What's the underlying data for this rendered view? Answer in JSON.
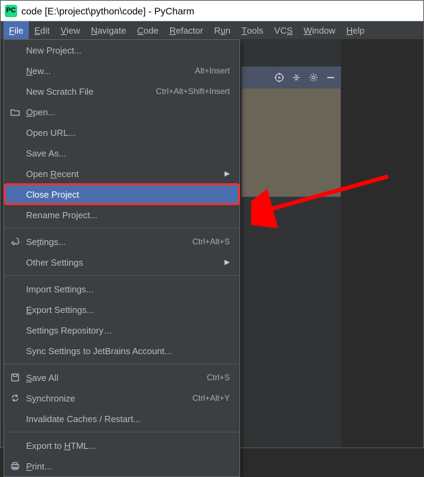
{
  "window": {
    "title": "code [E:\\project\\python\\code] - PyCharm"
  },
  "menubar": {
    "items": [
      {
        "label": "File",
        "underline": "F",
        "active": true
      },
      {
        "label": "Edit",
        "underline": "E"
      },
      {
        "label": "View",
        "underline": "V"
      },
      {
        "label": "Navigate",
        "underline": "N"
      },
      {
        "label": "Code",
        "underline": "C"
      },
      {
        "label": "Refactor",
        "underline": "R"
      },
      {
        "label": "Run",
        "underline": "u"
      },
      {
        "label": "Tools",
        "underline": "T"
      },
      {
        "label": "VCS",
        "underline": "S"
      },
      {
        "label": "Window",
        "underline": "W"
      },
      {
        "label": "Help",
        "underline": "H"
      }
    ]
  },
  "file_menu": {
    "groups": [
      [
        {
          "label": "New Project..."
        },
        {
          "label": "New...",
          "underline": "N",
          "shortcut": "Alt+Insert"
        },
        {
          "label": "New Scratch File",
          "shortcut": "Ctrl+Alt+Shift+Insert"
        },
        {
          "label": "Open...",
          "underline": "O",
          "icon": "folder-open-icon"
        },
        {
          "label": "Open URL..."
        },
        {
          "label": "Save As..."
        },
        {
          "label": "Open Recent",
          "underline": "R",
          "submenu": true
        },
        {
          "label": "Close Project",
          "selected": true
        },
        {
          "label": "Rename Project..."
        }
      ],
      [
        {
          "label": "Settings...",
          "underline": "t",
          "shortcut": "Ctrl+Alt+S",
          "icon": "wrench-icon"
        },
        {
          "label": "Other Settings",
          "submenu": true
        }
      ],
      [
        {
          "label": "Import Settings..."
        },
        {
          "label": "Export Settings...",
          "underline": "E"
        },
        {
          "label": "Settings Repository…"
        },
        {
          "label": "Sync Settings to JetBrains Account..."
        }
      ],
      [
        {
          "label": "Save All",
          "underline": "S",
          "shortcut": "Ctrl+S",
          "icon": "save-icon"
        },
        {
          "label": "Synchronize",
          "underline": "y",
          "shortcut": "Ctrl+Alt+Y",
          "icon": "sync-icon"
        },
        {
          "label": "Invalidate Caches / Restart..."
        }
      ],
      [
        {
          "label": "Export to HTML...",
          "underline": "H"
        },
        {
          "label": "Print...",
          "underline": "P",
          "icon": "print-icon"
        }
      ]
    ]
  },
  "side_toolbar": {
    "icons": [
      "target-icon",
      "collapse-icon",
      "gear-icon",
      "minimize-icon"
    ]
  },
  "annotation": {
    "arrow_color": "#ff0000"
  }
}
